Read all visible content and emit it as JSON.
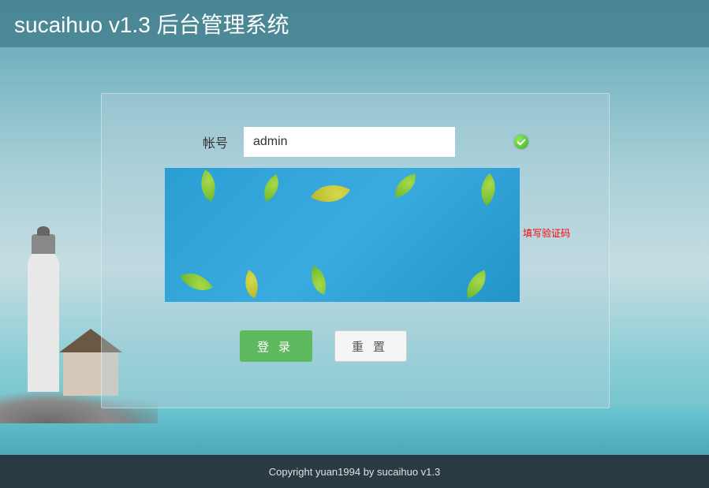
{
  "header": {
    "title": "sucaihuo v1.3 后台管理系统"
  },
  "form": {
    "account_label": "帐号",
    "account_value": "admin",
    "error_message": "填写验证码",
    "login_button": "登录",
    "reset_button": "重置"
  },
  "footer": {
    "copyright": "Copyright yuan1994 by sucaihuo v1.3"
  }
}
